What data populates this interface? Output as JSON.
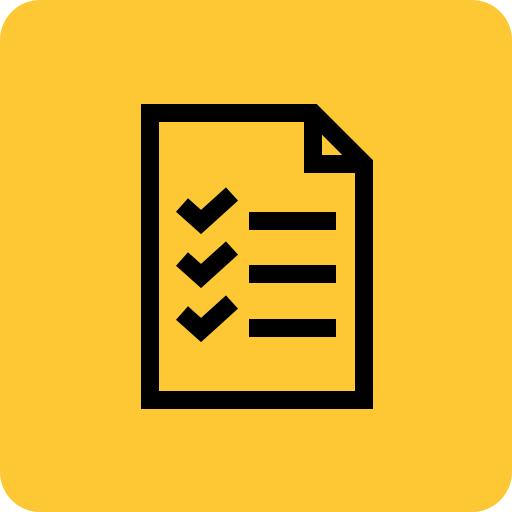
{
  "app_icon": {
    "icon": "checklist-document-icon",
    "background_color": "#FDC833",
    "foreground_color": "#000000",
    "checked_items": 3
  }
}
